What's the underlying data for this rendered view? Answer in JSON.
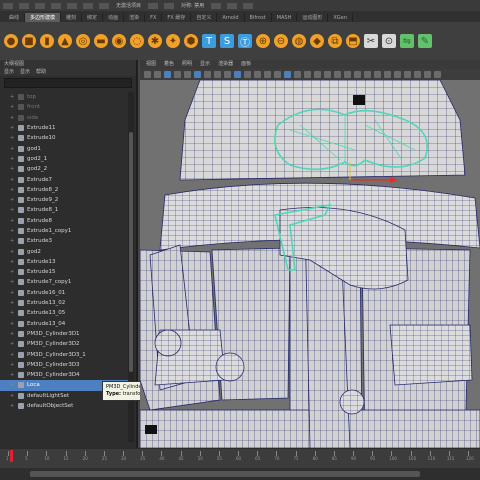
{
  "menubar": {
    "items": [
      "",
      "",
      "",
      "",
      "",
      "",
      "",
      "无激活项目",
      "",
      "",
      "对称: 禁用",
      "",
      "",
      ""
    ]
  },
  "shelf": {
    "tabs": [
      "曲线",
      "多边形建模",
      "雕刻",
      "绑定",
      "动画",
      "渲染",
      "FX",
      "FX 缓存",
      "自定义",
      "Arnold",
      "Bifrost",
      "MASH",
      "运动图形",
      "XGen"
    ],
    "active_tab": 1,
    "icons": [
      "sphere-icon",
      "cube-icon",
      "cylinder-icon",
      "cone-icon",
      "torus-icon",
      "plane-icon",
      "disc-icon",
      "pipe-icon",
      "helix-icon",
      "superellipse-icon",
      "sphere-soccer-icon",
      "text-icon",
      "svg-icon",
      "type-icon",
      "combine-icon",
      "separate-icon",
      "smooth-icon",
      "bevel-icon",
      "bridge-icon",
      "extrude-icon",
      "multicut-icon",
      "target-weld-icon",
      "mirror-icon",
      "quad-draw-icon"
    ]
  },
  "outliner": {
    "title": "大纲视图",
    "menu": [
      "显示",
      "显示",
      "帮助"
    ],
    "items": [
      {
        "label": "top",
        "dim": true
      },
      {
        "label": "front",
        "dim": true
      },
      {
        "label": "side",
        "dim": true
      },
      {
        "label": "Extrude11"
      },
      {
        "label": "Extrude10"
      },
      {
        "label": "god1"
      },
      {
        "label": "god2_1"
      },
      {
        "label": "god2_2"
      },
      {
        "label": "Extrude7"
      },
      {
        "label": "Extrude8_2"
      },
      {
        "label": "Extrude9_2"
      },
      {
        "label": "Extrude8_1"
      },
      {
        "label": "Extrude8"
      },
      {
        "label": "Extrude1_copy1"
      },
      {
        "label": "Extrude3"
      },
      {
        "label": "god2"
      },
      {
        "label": "Extrude13"
      },
      {
        "label": "Extrude15"
      },
      {
        "label": "Extrude7_copy1"
      },
      {
        "label": "Extrude16_01"
      },
      {
        "label": "Extrude13_02"
      },
      {
        "label": "Extrude13_05"
      },
      {
        "label": "Extrude13_04"
      },
      {
        "label": "PM3D_Cylinder3D1"
      },
      {
        "label": "PM3D_Cylinder3D2"
      },
      {
        "label": "PM3D_Cylinder3D3_1"
      },
      {
        "label": "PM3D_Cylinder3D3"
      },
      {
        "label": "PM3D_Cylinder3D4"
      },
      {
        "label": "Loca",
        "selected": true
      },
      {
        "label": "defaultLightSet"
      },
      {
        "label": "defaultObjectSet"
      }
    ]
  },
  "tooltip": {
    "name": "PM3D_Cylinder3D",
    "type_label": "Type:",
    "type_value": "transform"
  },
  "viewport": {
    "menu": [
      "视图",
      "着色",
      "照明",
      "显示",
      "渲染器",
      "面板"
    ],
    "mesh_color": "#d9d9d9",
    "wire_color": "#262a6b",
    "highlight_color": "#4fd6b5",
    "bg_color": "#717171"
  },
  "timeline": {
    "labels": [
      "1",
      "5",
      "10",
      "15",
      "20",
      "25",
      "30",
      "35",
      "40",
      "45",
      "50",
      "55",
      "60",
      "65",
      "70",
      "75",
      "80",
      "85",
      "90",
      "95",
      "100",
      "105",
      "110",
      "115",
      "120"
    ],
    "current": "1"
  }
}
